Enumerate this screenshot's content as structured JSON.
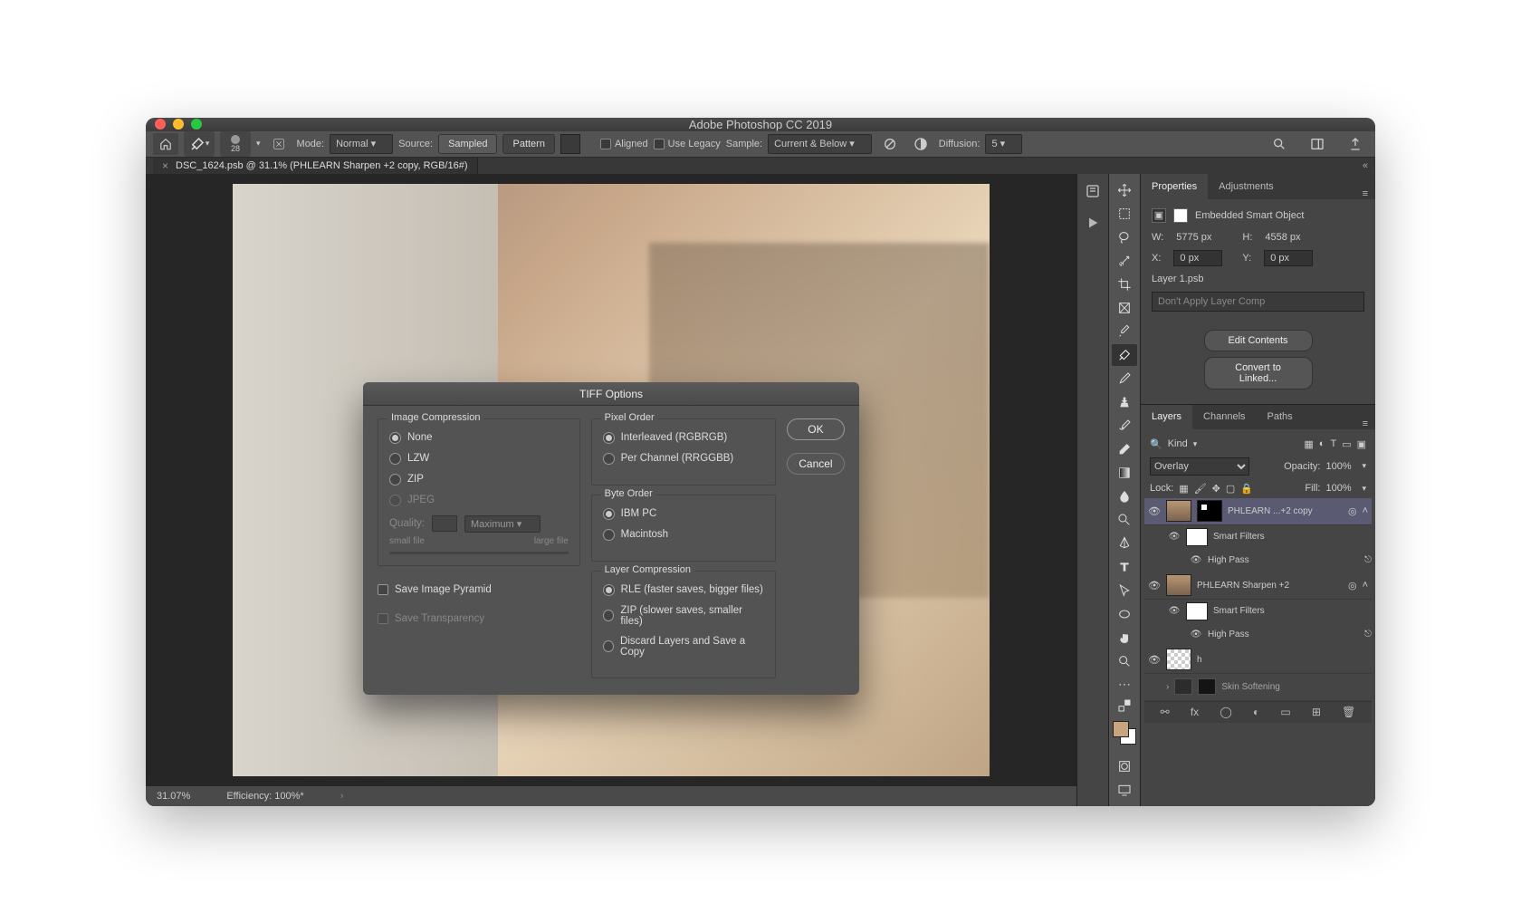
{
  "app_title": "Adobe Photoshop CC 2019",
  "options_bar": {
    "brush_size": "28",
    "mode_label": "Mode:",
    "mode_value": "Normal",
    "source_label": "Source:",
    "sampled": "Sampled",
    "pattern": "Pattern",
    "aligned": "Aligned",
    "use_legacy": "Use Legacy",
    "sample_label": "Sample:",
    "sample_value": "Current & Below",
    "diffusion_label": "Diffusion:",
    "diffusion_value": "5"
  },
  "document_tab": "DSC_1624.psb @ 31.1% (PHLEARN Sharpen +2 copy, RGB/16#)",
  "status": {
    "zoom": "31.07%",
    "efficiency": "Efficiency: 100%*"
  },
  "dialog": {
    "title": "TIFF Options",
    "image_compression": "Image Compression",
    "none": "None",
    "lzw": "LZW",
    "zip": "ZIP",
    "jpeg": "JPEG",
    "quality": "Quality:",
    "quality_preset": "Maximum",
    "small_file": "small file",
    "large_file": "large file",
    "save_pyramid": "Save Image Pyramid",
    "save_transparency": "Save Transparency",
    "pixel_order": "Pixel Order",
    "interleaved": "Interleaved (RGBRGB)",
    "per_channel": "Per Channel (RRGGBB)",
    "byte_order": "Byte Order",
    "ibm_pc": "IBM PC",
    "macintosh": "Macintosh",
    "layer_compression": "Layer Compression",
    "rle": "RLE (faster saves, bigger files)",
    "zip_layers": "ZIP (slower saves, smaller files)",
    "discard": "Discard Layers and Save a Copy",
    "ok": "OK",
    "cancel": "Cancel"
  },
  "properties": {
    "tab_props": "Properties",
    "tab_adjust": "Adjustments",
    "kind": "Embedded Smart Object",
    "w_label": "W:",
    "w_value": "5775 px",
    "h_label": "H:",
    "h_value": "4558 px",
    "x_label": "X:",
    "x_value": "0 px",
    "y_label": "Y:",
    "y_value": "0 px",
    "layer_file": "Layer 1.psb",
    "layer_comp": "Don't Apply Layer Comp",
    "edit_contents": "Edit Contents",
    "convert_linked": "Convert to Linked..."
  },
  "layers_panel": {
    "tab_layers": "Layers",
    "tab_channels": "Channels",
    "tab_paths": "Paths",
    "kind_label": "Kind",
    "blend_mode": "Overlay",
    "opacity_label": "Opacity:",
    "opacity_value": "100%",
    "lock_label": "Lock:",
    "fill_label": "Fill:",
    "fill_value": "100%",
    "layers": {
      "l0": "PHLEARN ...+2 copy",
      "smart_filters": "Smart Filters",
      "high_pass": "High Pass",
      "l1": "PHLEARN Sharpen +2",
      "l2": "h",
      "l3": "Skin Softening"
    }
  }
}
